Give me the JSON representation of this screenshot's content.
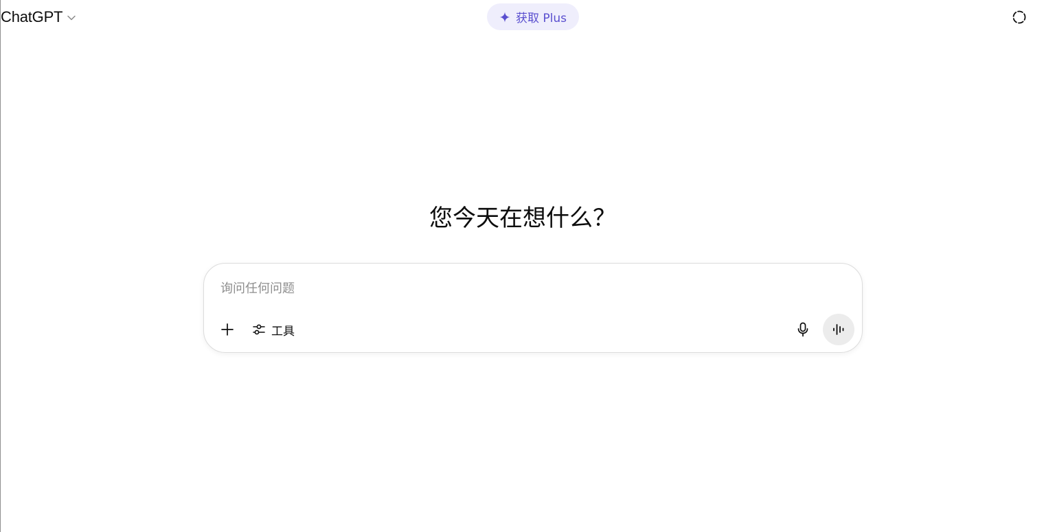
{
  "header": {
    "model_name": "ChatGPT",
    "upgrade_label": "获取 Plus",
    "icons": {
      "model_dropdown": "chevron-down-icon",
      "upgrade": "sparkle-icon",
      "temporary_chat": "dashed-circle-icon"
    }
  },
  "main": {
    "headline": "您今天在想什么？",
    "composer": {
      "placeholder": "询问任何问题",
      "value": "",
      "tools_label": "工具",
      "icons": {
        "attach": "plus-icon",
        "tools": "sliders-icon",
        "dictate": "microphone-icon",
        "voice_mode": "waveform-icon"
      }
    }
  },
  "colors": {
    "accent": "#5a4fcf",
    "upgrade_pill_bg": "#efeefc",
    "voice_button_bg": "#ececec",
    "composer_border": "#dcdcdc",
    "placeholder_text": "#8e8e8e"
  }
}
